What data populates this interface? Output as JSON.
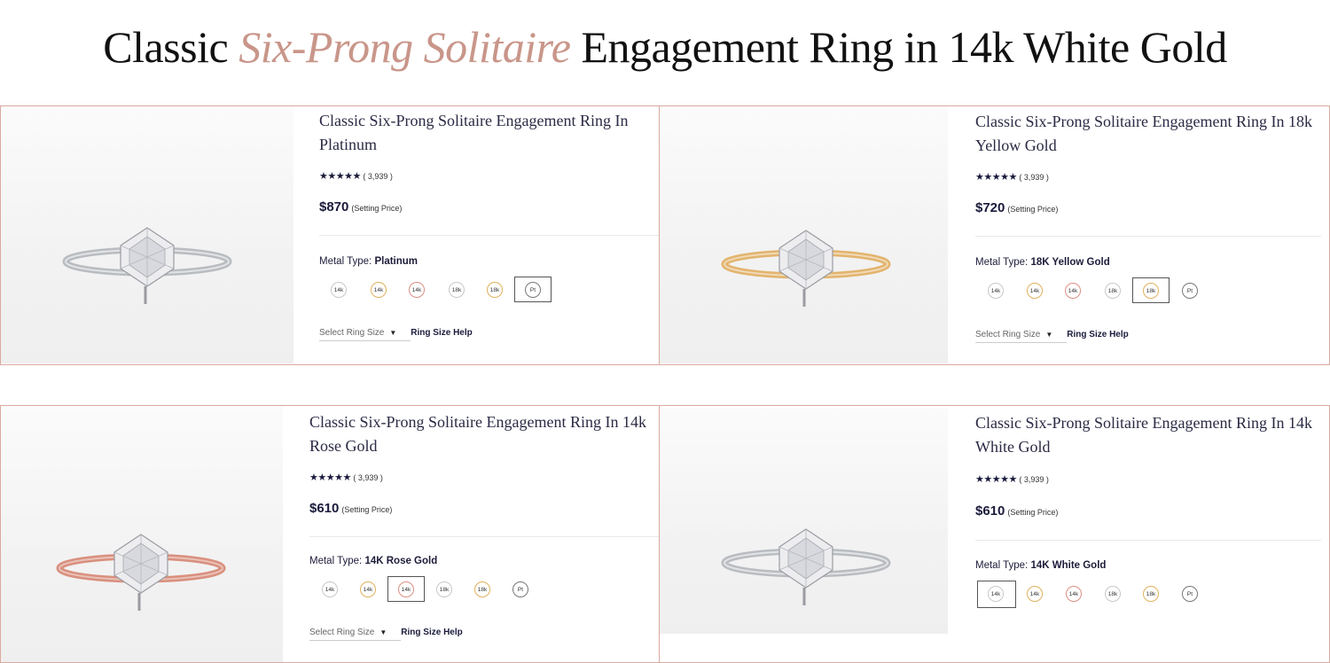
{
  "heading": {
    "prefix": "Classic ",
    "accent": "Six-Prong Solitaire",
    "suffix": " Engagement Ring in 14k White Gold"
  },
  "accent_color": "#c9968a",
  "shared": {
    "stars": "★★★★★",
    "reviews": "( 3,939 )",
    "price_note": "(Setting Price)",
    "metal_type_label": "Metal Type:",
    "ring_size_placeholder": "Select Ring Size",
    "ring_size_help": "Ring Size Help",
    "swatches": [
      {
        "label": "14k",
        "metal": "14k White Gold"
      },
      {
        "label": "14k",
        "metal": "14k Yellow Gold"
      },
      {
        "label": "14k",
        "metal": "14k Rose Gold"
      },
      {
        "label": "18k",
        "metal": "18k White Gold"
      },
      {
        "label": "18k",
        "metal": "18k Yellow Gold"
      },
      {
        "label": "Pt",
        "metal": "Platinum"
      }
    ]
  },
  "products": [
    {
      "title": "Classic Six-Prong Solitaire Engagement Ring In Platinum",
      "price": "$870",
      "metal": "Platinum",
      "band_color": "#c9cbcf",
      "selected_swatch": "Platinum"
    },
    {
      "title": "Classic Six-Prong Solitaire Engagement Ring In 18k Yellow Gold",
      "price": "$720",
      "metal": "18K Yellow Gold",
      "band_color": "#e2b46e",
      "selected_swatch": "18k Yellow Gold"
    },
    {
      "title": "Classic Six-Prong Solitaire Engagement Ring In 14k Rose Gold",
      "price": "$610",
      "metal": "14K Rose Gold",
      "band_color": "#d9907e",
      "selected_swatch": "14k Rose Gold"
    },
    {
      "title": "Classic Six-Prong Solitaire Engagement Ring In 14k White Gold",
      "price": "$610",
      "metal": "14K White Gold",
      "band_color": "#c9cbcf",
      "selected_swatch": "14k White Gold"
    }
  ]
}
